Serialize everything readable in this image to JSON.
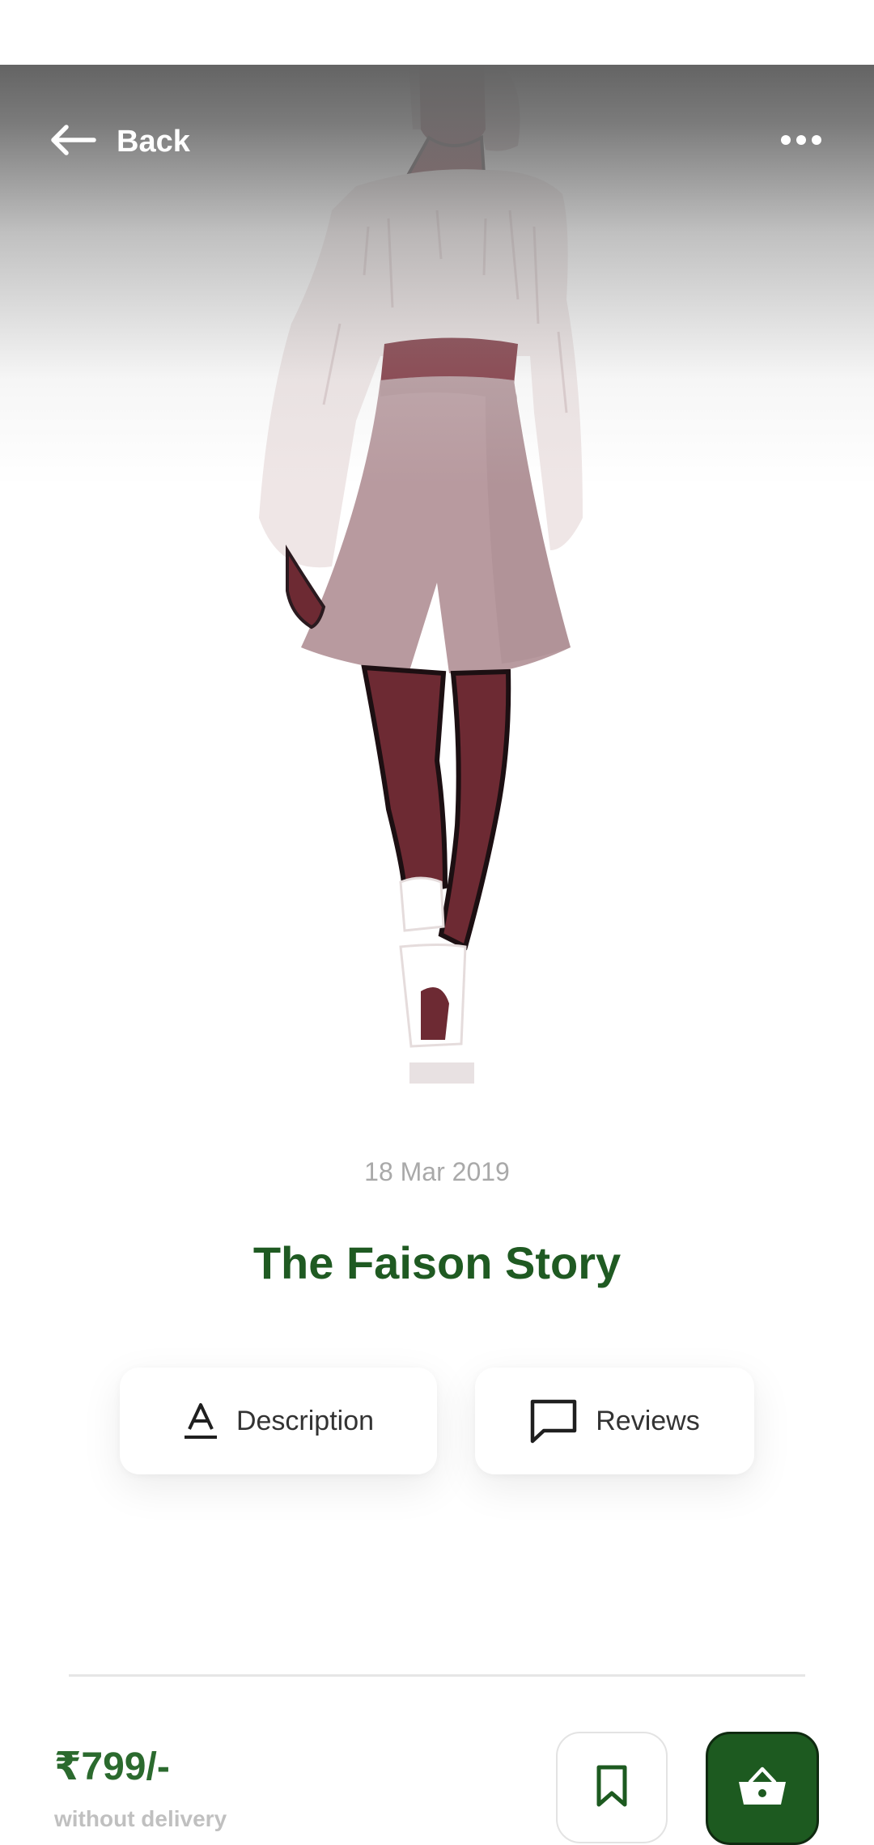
{
  "header": {
    "back_label": "Back",
    "back_icon": "arrow-left-icon",
    "more_icon": "more-horizontal-icon"
  },
  "product": {
    "date": "18 Mar 2019",
    "title": "The Faison Story",
    "image": "fashion-illustration"
  },
  "tabs": [
    {
      "label": "Description",
      "icon": "text-format-icon"
    },
    {
      "label": "Reviews",
      "icon": "message-square-icon"
    }
  ],
  "footer": {
    "price": "₹799/-",
    "price_note": "without delivery",
    "bookmark_icon": "bookmark-icon",
    "cart_icon": "basket-icon"
  },
  "colors": {
    "accent": "#1f5a22",
    "cart_button_bg": "#1d5a20",
    "muted_text": "#a9a9a9"
  }
}
